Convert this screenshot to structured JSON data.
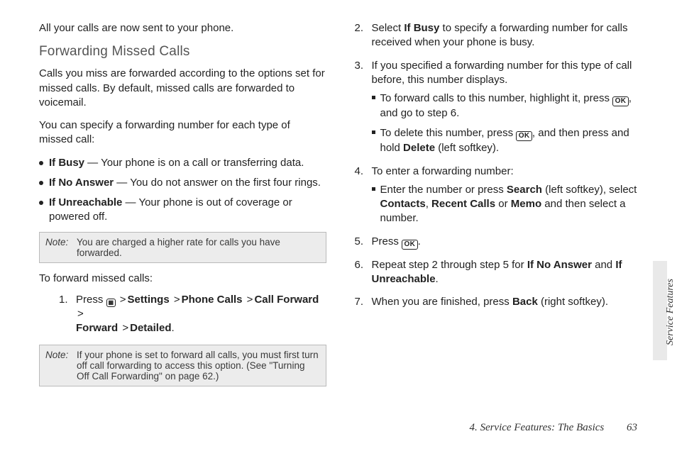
{
  "left": {
    "sent_line": "All your calls are now sent to your phone.",
    "subheading": "Forwarding Missed Calls",
    "para1": "Calls you miss are forwarded according to the options set for missed calls. By default, missed calls are forwarded to voicemail.",
    "para2": "You can specify a forwarding number for each type of missed call:",
    "bullets": {
      "b1_label": "If Busy",
      "b1_text": " — Your phone is on a call or transferring data.",
      "b2_label": "If No Answer",
      "b2_text": " — You do not answer on the first four rings.",
      "b3_label": "If Unreachable",
      "b3_text": " — Your phone is out of coverage or powered off."
    },
    "note1_label": "Note:",
    "note1_body": "You are charged a higher rate for calls you have forwarded.",
    "lead_in": "To forward missed calls:",
    "step1_prefix": "Press ",
    "nav": {
      "settings": "Settings",
      "phone_calls": "Phone Calls",
      "call_forward": "Call Forward",
      "forward": "Forward",
      "detailed": "Detailed"
    },
    "note2_label": "Note:",
    "note2_body": "If your phone is set to forward all calls, you must first turn off call forwarding to access this option. (See \"Turning Off Call Forwarding\" on page 62.)"
  },
  "right": {
    "s2_a": "Select ",
    "s2_bold": "If Busy",
    "s2_b": " to specify a forwarding number for calls received when your phone is busy.",
    "s3": "If you specified a forwarding number for this type of call before, this number displays.",
    "s3_sub1_a": "To forward calls to this number, highlight it, press ",
    "s3_sub1_b": ", and go to step 6.",
    "s3_sub2_a": "To delete this number, press ",
    "s3_sub2_b": ", and then press and hold ",
    "s3_sub2_bold": "Delete",
    "s3_sub2_c": " (left softkey).",
    "s4": "To enter a forwarding number:",
    "s4_sub_a": "Enter the number or press ",
    "s4_sub_search": "Search",
    "s4_sub_b": " (left softkey), select ",
    "s4_sub_contacts": "Contacts",
    "s4_sub_comma1": ", ",
    "s4_sub_recent": "Recent Calls",
    "s4_sub_or": " or ",
    "s4_sub_memo": "Memo",
    "s4_sub_c": " and then select a number.",
    "s5_a": "Press ",
    "s5_b": ".",
    "s6_a": "Repeat step 2 through step 5 for ",
    "s6_bold1": "If No Answer",
    "s6_and": " and ",
    "s6_bold2": "If Unreachable",
    "s6_b": ".",
    "s7_a": "When you are finished, press ",
    "s7_bold": "Back",
    "s7_b": " (right softkey)."
  },
  "keys": {
    "ok": "OK",
    "menu": "▦"
  },
  "footer": {
    "chapter": "4. Service Features: The Basics",
    "page": "63"
  },
  "side_tab": "Service Features",
  "gt": ">"
}
